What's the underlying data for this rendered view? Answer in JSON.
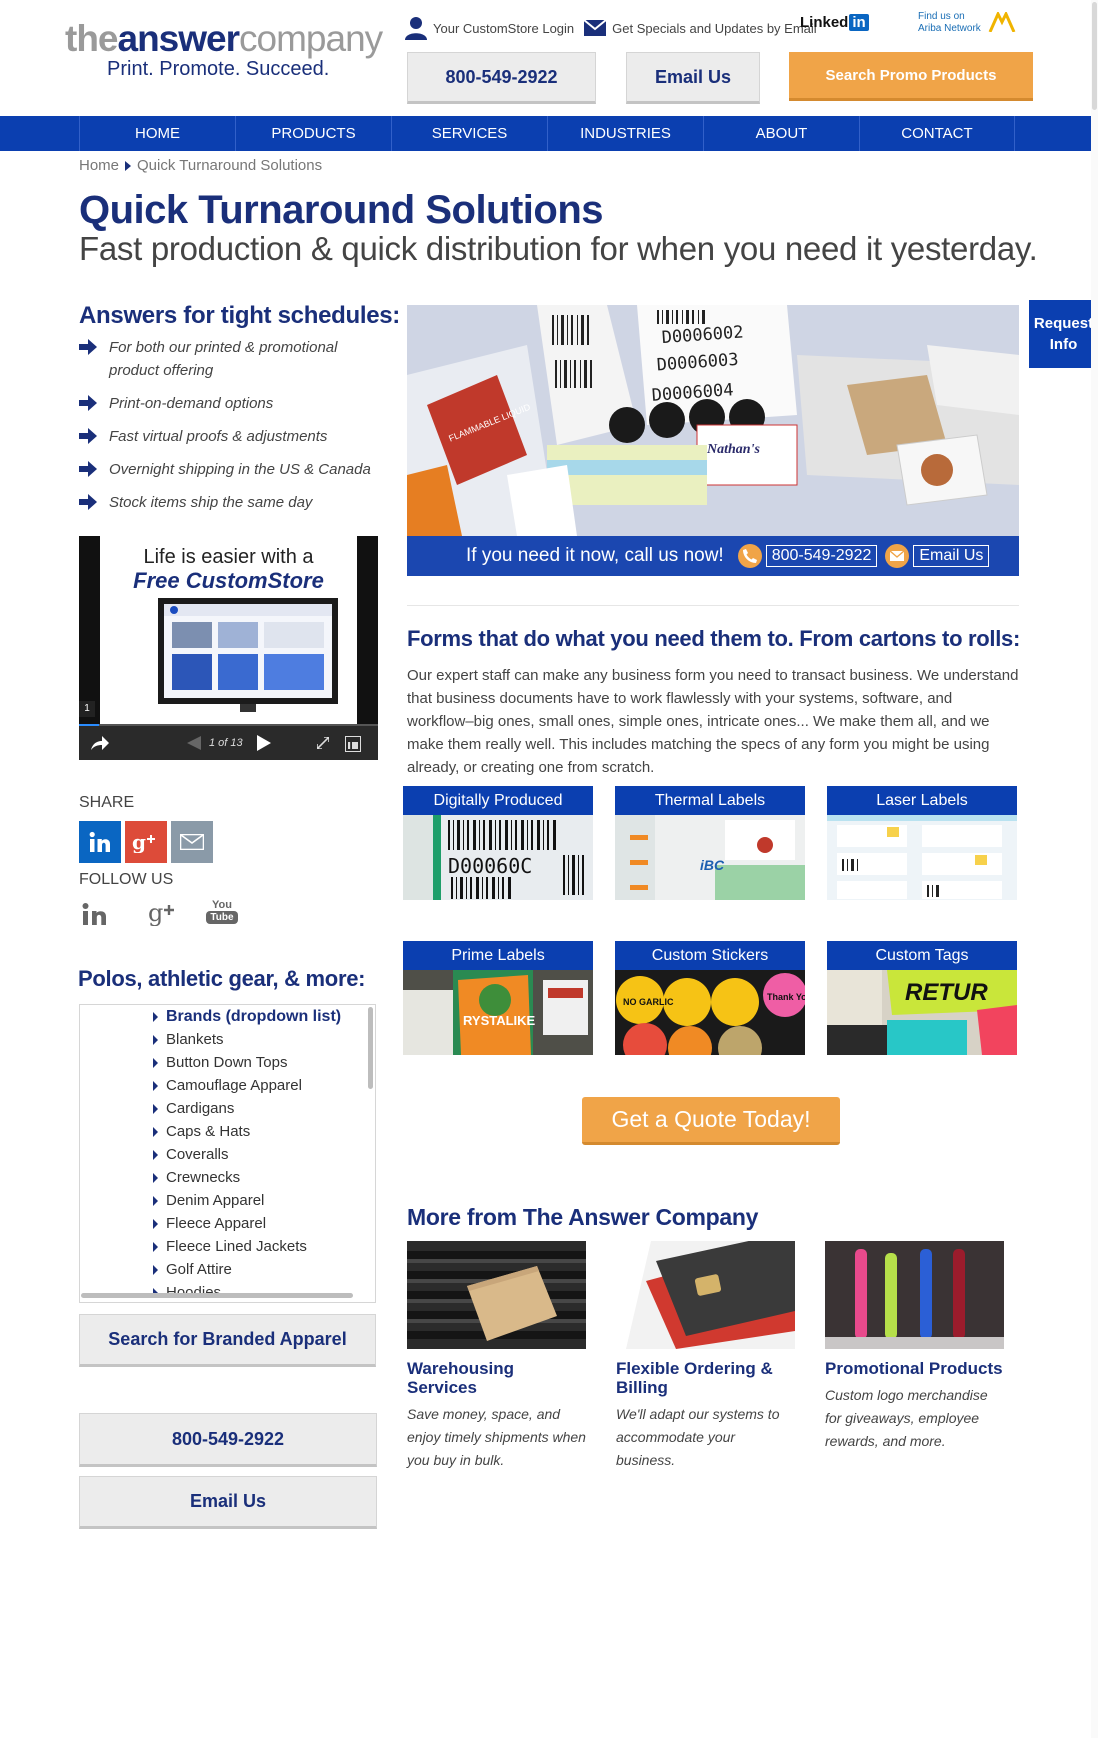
{
  "header": {
    "logo_the": "the",
    "logo_answer": "answer",
    "logo_company": "company",
    "logo_tagline": "Print. Promote. Succeed.",
    "login_label": "Your CustomStore Login",
    "specials_label": "Get Specials and Updates by Email",
    "linkedin_text": "Linked",
    "linkedin_in": "in",
    "ariba_line1": "Find us on",
    "ariba_line2": "Ariba Network",
    "phone_button": "800-549-2922",
    "email_button": "Email Us",
    "search_promo_button": "Search Promo Products"
  },
  "nav": {
    "items": [
      "HOME",
      "PRODUCTS",
      "SERVICES",
      "INDUSTRIES",
      "ABOUT",
      "CONTACT"
    ]
  },
  "breadcrumb": {
    "home": "Home",
    "current": "Quick Turnaround Solutions"
  },
  "page": {
    "title": "Quick Turnaround Solutions",
    "subtitle": "Fast production & quick distribution for when you need it yesterday."
  },
  "request_info": {
    "line1": "Request",
    "line2": "Info"
  },
  "schedules": {
    "heading": "Answers for tight schedules:",
    "items": [
      "For both our printed & promotional product offering",
      "Print-on-demand options",
      "Fast virtual proofs & adjustments",
      "Overnight shipping in the US & Canada",
      "Stock items ship the same day"
    ]
  },
  "video": {
    "headline1": "Life is easier with a",
    "headline2": "Free CustomStore",
    "counter": "1 of 13",
    "slide_num": "1"
  },
  "social": {
    "share_label": "SHARE",
    "follow_label": "FOLLOW US",
    "youtube_you": "You",
    "youtube_tube": "Tube"
  },
  "apparel": {
    "heading": "Polos, athletic gear, & more:",
    "items": [
      "Brands (dropdown list)",
      "Blankets",
      "Button Down Tops",
      "Camouflage Apparel",
      "Cardigans",
      "Caps & Hats",
      "Coveralls",
      "Crewnecks",
      "Denim Apparel",
      "Fleece Apparel",
      "Fleece Lined Jackets",
      "Golf Attire",
      "Hoodies"
    ],
    "search_button": "Search for Branded Apparel"
  },
  "contact_buttons": {
    "phone": "800-549-2922",
    "email": "Email Us"
  },
  "hero": {
    "callout": "If you need it now, call us now!",
    "phone": "800-549-2922",
    "email": "Email Us",
    "label_codes": [
      "D0006002",
      "D0006003",
      "D0006004"
    ],
    "flammable": "FLAMMABLE LIQUID",
    "nathans": "Nathan's"
  },
  "forms": {
    "heading": "Forms that do what you need them to. From cartons to rolls:",
    "body": "Our expert staff can make any business form you need to transact business. We understand that business documents have to work flawlessly with your systems, software, and workflow–big ones, small ones, simple ones, intricate ones... We make them all, and we make them really well. This includes matching the specs of any form you might be using already, or creating one from scratch."
  },
  "tiles": [
    {
      "label": "Digitally Produced"
    },
    {
      "label": "Thermal Labels"
    },
    {
      "label": "Laser Labels"
    },
    {
      "label": "Prime Labels"
    },
    {
      "label": "Custom Stickers"
    },
    {
      "label": "Custom Tags"
    }
  ],
  "tile_text": {
    "digital_code": "D00060C",
    "thermal_brand": "iBC",
    "prime_brand": "RYSTALIKE",
    "stickers": [
      "NO GARLIC",
      "Thank You!"
    ],
    "tags": "RETUR"
  },
  "quote_button": "Get a Quote Today!",
  "more": {
    "heading": "More from The Answer Company",
    "cards": [
      {
        "title": "Warehousing Services",
        "desc": "Save money, space, and enjoy timely shipments when you buy in bulk."
      },
      {
        "title": "Flexible Ordering & Billing",
        "desc": "We'll adapt our systems to accommodate your business."
      },
      {
        "title": "Promotional Products",
        "desc": "Custom logo merchandise for giveaways, employee rewards, and more."
      }
    ]
  },
  "colors": {
    "navy": "#1a2f7a",
    "nav_blue": "#0b3fb0",
    "orange": "#f0a448",
    "linkedin": "#0a66c2",
    "googleplus": "#dd4b39",
    "email_grey": "#8a9aa8"
  }
}
